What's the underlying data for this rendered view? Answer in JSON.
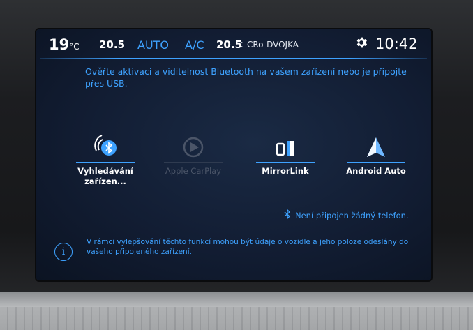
{
  "status_bar": {
    "temp_left": "19",
    "temp_left_unit": "°C",
    "fan_value": "20.5",
    "auto_label": "AUTO",
    "ac_label": "A/C",
    "temp_right": "20.5",
    "separator": ":",
    "profile_name": "CRo-DVOJKA",
    "time": "10:42",
    "gear_icon": "gear-icon"
  },
  "message": "Ověřte aktivaci a viditelnost Bluetooth na vašem zařízení nebo je připojte přes USB.",
  "tiles": [
    {
      "label_line1": "Vyhledávání",
      "label_line2": "zařízen...",
      "icon": "bluetooth-search-icon",
      "enabled": true
    },
    {
      "label_line1": "Apple CarPlay",
      "label_line2": "",
      "icon": "carplay-icon",
      "enabled": false
    },
    {
      "label_line1": "MirrorLink",
      "label_line2": "",
      "icon": "mirrorlink-icon",
      "enabled": true
    },
    {
      "label_line1": "Android Auto",
      "label_line2": "",
      "icon": "android-auto-icon",
      "enabled": true
    }
  ],
  "bluetooth_status": "Není připojen žádný telefon.",
  "info_text": "V rámci vylepšování těchto funkcí mohou být údaje o vozidle a jeho poloze odeslány do vašeho připojeného zařízení.",
  "colors": {
    "accent": "#3ea2ff",
    "screen_bg": "#121d33",
    "text": "#ffffff"
  }
}
